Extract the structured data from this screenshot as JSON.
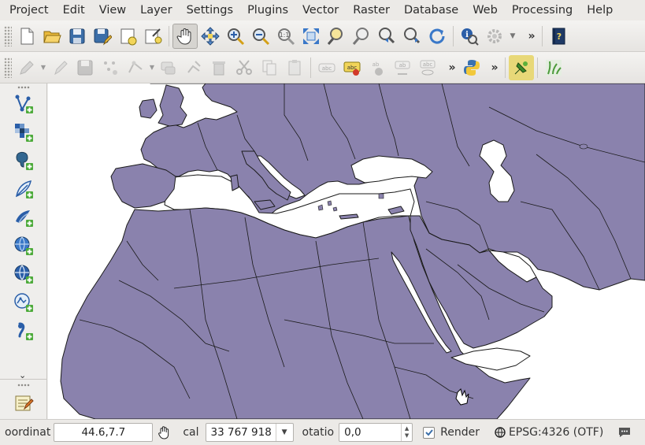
{
  "menu": [
    "Project",
    "Edit",
    "View",
    "Layer",
    "Settings",
    "Plugins",
    "Vector",
    "Raster",
    "Database",
    "Web",
    "Processing",
    "Help"
  ],
  "toolbar1": {
    "buttons": [
      "new-project-icon",
      "open-folder-icon",
      "save-icon",
      "save-as-icon",
      "new-print-composer-icon",
      "composer-manager-icon",
      "pan-hand-icon",
      "pan-to-selection-icon",
      "zoom-in-icon",
      "zoom-out-icon",
      "zoom-actual-size-icon",
      "zoom-full-icon",
      "zoom-to-selection-icon",
      "zoom-to-layer-icon",
      "zoom-last-icon",
      "zoom-next-icon",
      "refresh-icon",
      "identify-icon",
      "settings-gear-icon",
      "help-book-icon"
    ],
    "overflow": "»"
  },
  "toolbar2": {
    "buttons": [
      "edits-pencil-icon",
      "toggle-editing-icon",
      "save-edits-icon",
      "add-feature-icon",
      "node-tool-icon",
      "move-feature-icon",
      "node-tool2-icon",
      "delete-icon",
      "cut-icon",
      "copy-icon",
      "paste-icon",
      "label-abc-icon",
      "label-pin-icon",
      "label-move-icon",
      "label-rotate-icon",
      "label-show-icon",
      "python-icon",
      "plugin-green-icon",
      "plugin-grass-icon"
    ],
    "overflow": "»"
  },
  "sidebar": {
    "buttons": [
      "add-vector-layer-icon",
      "add-raster-layer-icon",
      "add-postgis-layer-icon",
      "add-spatialite-layer-icon",
      "add-mssql-layer-icon",
      "add-wms-layer-icon",
      "add-wcs-layer-icon",
      "add-wfs-layer-icon",
      "add-delimited-text-icon",
      "new-shapefile-icon"
    ],
    "chevron": "⌄"
  },
  "map": {
    "land_color": "#8a82ad",
    "border_color": "#1a1a1a",
    "background": "#ffffff"
  },
  "status": {
    "coordinate_label": "oordinat",
    "coordinate_value": "44.6,7.7",
    "scale_label": "cal",
    "scale_value": "33 767 918",
    "rotation_label": "otatio",
    "rotation_value": "0,0",
    "render_label": "Render",
    "render_checked": true,
    "crs_label": "EPSG:4326 (OTF)"
  }
}
